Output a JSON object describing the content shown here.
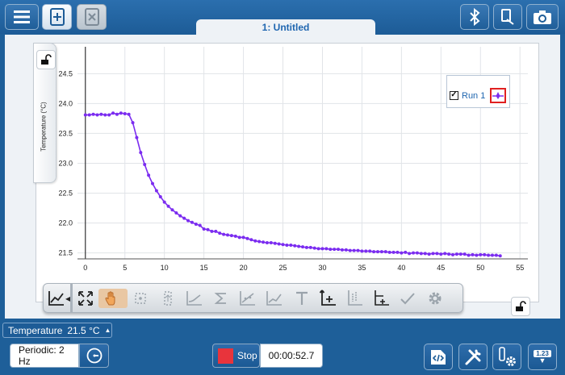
{
  "window": {
    "tab_title": "1: Untitled"
  },
  "toolbar": {
    "left_icons": [
      "menu-icon",
      "new-file-icon",
      "close-file-icon"
    ],
    "right_icons": [
      "bluetooth-icon",
      "connected-device-icon",
      "camera-icon"
    ]
  },
  "graph": {
    "y_axis_label": "Temperature (°C)",
    "legend": {
      "run_label": "Run 1",
      "checked": true
    },
    "series_color": "#7b2cf0",
    "legend_highlight_color": "#e02020"
  },
  "chart_data": {
    "type": "line",
    "title": "",
    "xlabel": "",
    "ylabel": "Temperature (°C)",
    "xlim": [
      -1,
      56
    ],
    "ylim": [
      21.4,
      24.95
    ],
    "x_ticks": [
      0,
      5,
      10,
      15,
      20,
      25,
      30,
      35,
      40,
      45,
      50,
      55
    ],
    "y_ticks": [
      21.5,
      22.0,
      22.5,
      23.0,
      23.5,
      24.0,
      24.5
    ],
    "x_tick_labels": [
      "0",
      "5",
      "10",
      "15",
      "20",
      "25",
      "30",
      "35",
      "40",
      "45",
      "50",
      "55"
    ],
    "y_tick_labels": [
      "21.5",
      "22.0",
      "22.5",
      "23.0",
      "23.5",
      "24.0",
      "24.5"
    ],
    "grid": true,
    "legend_position": "top-right",
    "series": [
      {
        "name": "Run 1",
        "x": [
          0,
          0.5,
          1,
          1.5,
          2,
          2.5,
          3,
          3.5,
          4,
          4.5,
          5,
          5.5,
          6,
          6.5,
          7,
          7.5,
          8,
          8.5,
          9,
          9.5,
          10,
          10.5,
          11,
          11.5,
          12,
          12.5,
          13,
          13.5,
          14,
          14.5,
          15,
          15.5,
          16,
          16.5,
          17,
          17.5,
          18,
          18.5,
          19,
          19.5,
          20,
          20.5,
          21,
          21.5,
          22,
          22.5,
          23,
          23.5,
          24,
          24.5,
          25,
          25.5,
          26,
          26.5,
          27,
          27.5,
          28,
          28.5,
          29,
          29.5,
          30,
          30.5,
          31,
          31.5,
          32,
          32.5,
          33,
          33.5,
          34,
          34.5,
          35,
          35.5,
          36,
          36.5,
          37,
          37.5,
          38,
          38.5,
          39,
          39.5,
          40,
          40.5,
          41,
          41.5,
          42,
          42.5,
          43,
          43.5,
          44,
          44.5,
          45,
          45.5,
          46,
          46.5,
          47,
          47.5,
          48,
          48.5,
          49,
          49.5,
          50,
          50.5,
          51,
          51.5,
          52,
          52.5
        ],
        "y": [
          23.81,
          23.81,
          23.82,
          23.81,
          23.82,
          23.81,
          23.81,
          23.84,
          23.82,
          23.84,
          23.83,
          23.82,
          23.68,
          23.43,
          23.18,
          22.98,
          22.8,
          22.66,
          22.54,
          22.44,
          22.35,
          22.28,
          22.22,
          22.17,
          22.12,
          22.08,
          22.04,
          22.01,
          21.98,
          21.96,
          21.9,
          21.89,
          21.86,
          21.86,
          21.83,
          21.81,
          21.8,
          21.79,
          21.78,
          21.76,
          21.76,
          21.74,
          21.72,
          21.7,
          21.69,
          21.68,
          21.67,
          21.67,
          21.66,
          21.65,
          21.64,
          21.63,
          21.63,
          21.62,
          21.61,
          21.6,
          21.59,
          21.59,
          21.58,
          21.57,
          21.57,
          21.57,
          21.56,
          21.56,
          21.56,
          21.55,
          21.55,
          21.54,
          21.54,
          21.54,
          21.53,
          21.53,
          21.53,
          21.52,
          21.52,
          21.52,
          21.52,
          21.51,
          21.51,
          21.51,
          21.5,
          21.51,
          21.49,
          21.5,
          21.5,
          21.49,
          21.49,
          21.48,
          21.49,
          21.49,
          21.48,
          21.49,
          21.48,
          21.47,
          21.48,
          21.48,
          21.48,
          21.46,
          21.47,
          21.46,
          21.47,
          21.47,
          21.46,
          21.46,
          21.46,
          21.45
        ]
      }
    ]
  },
  "graph_toolbar": {
    "icons": [
      "graph-type-icon",
      "autoscale-icon",
      "pan-icon",
      "examine-icon",
      "selection-icon",
      "tangent-icon",
      "statistics-icon",
      "curve-fit-icon",
      "model-icon",
      "annotation-icon",
      "add-axis-icon",
      "graph-options-icon",
      "interpolate-icon",
      "check-icon",
      "settings-icon"
    ]
  },
  "sensor": {
    "name": "Temperature",
    "value": "21.5 °C"
  },
  "bottom": {
    "rate_label": "Periodic: 2 Hz",
    "stop_label": "Stop",
    "timer": "00:00:52.7",
    "meter_value": "1.23",
    "right_icons": [
      "code-icon",
      "tools-icon",
      "sensor-settings-icon",
      "meter-icon"
    ]
  }
}
